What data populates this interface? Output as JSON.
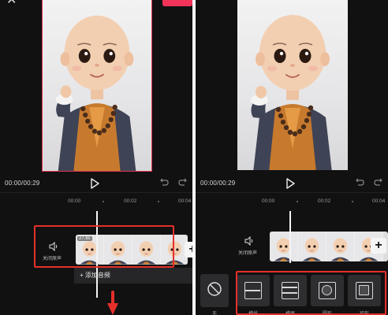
{
  "left": {
    "time": "00:00/00:29",
    "ruler": [
      "00:00",
      "00:02",
      "00:04"
    ],
    "mute_label": "关闭原声",
    "clip_duration": "27.8s",
    "add_audio_label": "+ 添加音频",
    "add_clip": "+"
  },
  "right": {
    "time": "00:00/00:29",
    "ruler": [
      "00:00",
      "00:02",
      "00:04"
    ],
    "mute_label": "关闭原声",
    "add_clip": "+",
    "none_label": "无",
    "transitions": [
      {
        "label": "横线",
        "icon": "split-horizontal-icon"
      },
      {
        "label": "横屏",
        "icon": "bars-horizontal-icon"
      },
      {
        "label": "圆形",
        "icon": "circle-icon"
      },
      {
        "label": "矩形",
        "icon": "rectangle-icon"
      }
    ]
  },
  "colors": {
    "accent_red": "#e5302b",
    "export_pink": "#f2335a",
    "background": "#111112"
  }
}
